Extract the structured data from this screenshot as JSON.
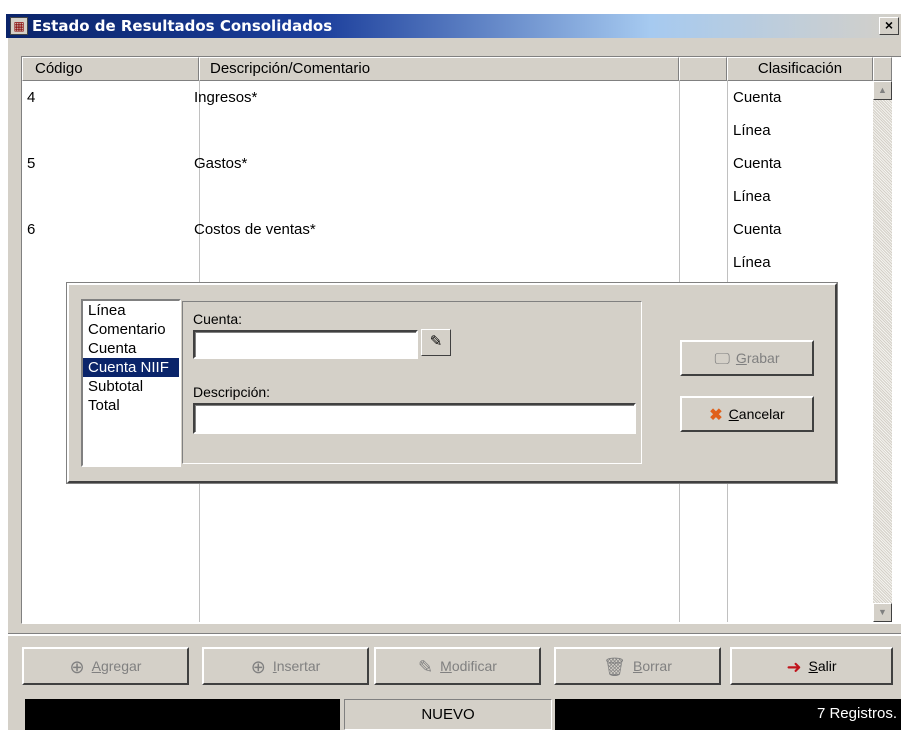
{
  "window": {
    "title": "Estado de Resultados Consolidados",
    "close_label": "×"
  },
  "grid": {
    "columns": [
      "Código",
      "Descripción/Comentario",
      "",
      "Clasificación"
    ],
    "rows": [
      {
        "codigo": "4",
        "descripcion": "Ingresos*",
        "clasificacion": "Cuenta"
      },
      {
        "codigo": "",
        "descripcion": "",
        "clasificacion": "Línea"
      },
      {
        "codigo": "5",
        "descripcion": "Gastos*",
        "clasificacion": "Cuenta"
      },
      {
        "codigo": "",
        "descripcion": "",
        "clasificacion": "Línea"
      },
      {
        "codigo": "6",
        "descripcion": "Costos de ventas*",
        "clasificacion": "Cuenta"
      },
      {
        "codigo": "",
        "descripcion": "",
        "clasificacion": "Línea"
      }
    ]
  },
  "dialog": {
    "types": [
      "Línea",
      "Comentario",
      "Cuenta",
      "Cuenta NIIF",
      "Subtotal",
      "Total"
    ],
    "selected_type": "Cuenta NIIF",
    "cuenta_label": "Cuenta:",
    "cuenta_value": "",
    "descripcion_label": "Descripción:",
    "descripcion_value": "",
    "grabar": {
      "hotkey": "G",
      "rest": "rabar",
      "enabled": false
    },
    "cancelar": {
      "hotkey": "C",
      "rest": "ancelar",
      "enabled": true
    }
  },
  "toolbar": {
    "agregar": {
      "hotkey": "A",
      "rest": "gregar",
      "enabled": false
    },
    "insertar": {
      "hotkey": "I",
      "rest": "nsertar",
      "enabled": false
    },
    "modificar": {
      "hotkey": "M",
      "rest": "odificar",
      "enabled": false
    },
    "borrar": {
      "hotkey": "B",
      "rest": "orrar",
      "enabled": false
    },
    "salir": {
      "hotkey": "S",
      "rest": "alir",
      "enabled": true
    }
  },
  "statusbar": {
    "left": "",
    "mode": "NUEVO",
    "records": "7 Registros."
  },
  "icons": {
    "app": "app-window-icon",
    "lookup": "search-lookup-icon",
    "grabar": "monitor-save-icon",
    "cancelar": "red-x-icon",
    "agregar": "add-box-icon",
    "insertar": "insert-box-icon",
    "modificar": "edit-pencil-icon",
    "borrar": "trash-icon",
    "salir": "exit-door-icon"
  },
  "colors": {
    "title_bar": "#0a246a",
    "selection": "#0a246a",
    "face": "#d4d0c8",
    "cancel_icon": "#e0601a",
    "exit_icon": "#c0141c"
  }
}
